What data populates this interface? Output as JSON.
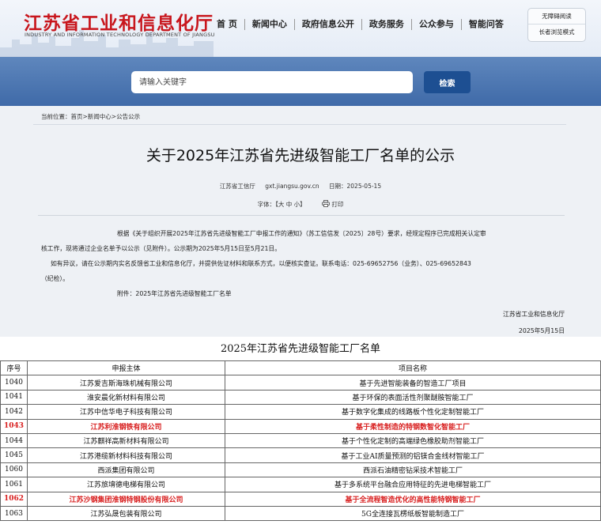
{
  "header": {
    "logo_title": "江苏省工业和信息化厅",
    "logo_subtitle": "INDUSTRY AND INFORMATION TECHNOLOGY DEPARTMENT OF JIANGSU",
    "nav": [
      "首 页",
      "新闻中心",
      "政府信息公开",
      "政务服务",
      "公众参与",
      "智能问答"
    ],
    "accessibility": [
      "无障碍阅读",
      "长者浏览模式"
    ]
  },
  "search": {
    "placeholder": "请输入关键字",
    "button": "检索"
  },
  "breadcrumb": {
    "label": "当前位置：",
    "path": "首页>新闻中心>公告公示"
  },
  "article": {
    "title": "关于2025年江苏省先进级智能工厂名单的公示",
    "source": "江苏省工信厅",
    "site": "gxt.jiangsu.gov.cn",
    "date": "日期：2025-05-15",
    "font_label": "字体：【",
    "font_sizes": "大  中  小",
    "font_close": "】",
    "print_label": "打印",
    "para1_line1": "根据《关于组织开展2025年江苏省先进级智能工厂申报工作的通知》（苏工信信发〔2025〕28号）要求，经规定程序已完成相关认定审",
    "para1_line2": "核工作，现将通过企业名单予以公示（见附件）。公示期为2025年5月15日至5月21日。",
    "para2_line1": "如有异议，请在公示期内实名反馈省工业和信息化厅，并提供佐证材料和联系方式，以便核实查证。联系电话：025-69652756（业务）、025-69652843",
    "para2_line2": "（纪检）。",
    "attachment": "附件：2025年江苏省先进级智能工厂名单",
    "signoff_org": "江苏省工业和信息化厅",
    "signoff_date": "2025年5月15日"
  },
  "table": {
    "title": "2025年江苏省先进级智能工厂名单",
    "headers": [
      "序号",
      "申报主体",
      "项目名称"
    ],
    "rows": [
      {
        "no": "1040",
        "company": "江苏爱吉斯海珠机械有限公司",
        "project": "基于先进智能装备的智造工厂项目",
        "highlight": false
      },
      {
        "no": "1041",
        "company": "淮安晨化新材料有限公司",
        "project": "基于环保的表面活性剂聚醚胺智能工厂",
        "highlight": false
      },
      {
        "no": "1042",
        "company": "江苏中信华电子科技有限公司",
        "project": "基于数字化集成的线路板个性化定制智能工厂",
        "highlight": false
      },
      {
        "no": "1043",
        "company": "江苏利淮钢铁有限公司",
        "project": "基于柔性制造的特钢数智化智能工厂",
        "highlight": true
      },
      {
        "no": "1044",
        "company": "江苏麒祥高新材料有限公司",
        "project": "基于个性化定制的高端绿色橡胶助剂智能工厂",
        "highlight": false
      },
      {
        "no": "1045",
        "company": "江苏港缆新材料科技有限公司",
        "project": "基于工业AI质量预测的铝镁合金线材智能工厂",
        "highlight": false
      },
      {
        "no": "1060",
        "company": "西派集团有限公司",
        "project": "西派石油精密钻采技术智能工厂",
        "highlight": false
      },
      {
        "no": "1061",
        "company": "江苏旅堉德电梯有限公司",
        "project": "基于多系统平台融合应用特征的先进电梯智能工厂",
        "highlight": false
      },
      {
        "no": "1062",
        "company": "江苏沙钢集团淮钢特钢股份有限公司",
        "project": "基于全流程智造优化的高性能特钢智能工厂",
        "highlight": true
      },
      {
        "no": "1063",
        "company": "江苏弘晟包装有限公司",
        "project": "5G全连接瓦楞纸板智能制造工厂",
        "highlight": false
      }
    ]
  },
  "colors": {
    "brand_red": "#c8161d",
    "search_band": "#4a74b0",
    "search_button": "#1d4f92",
    "highlight_text": "#d81e1e"
  }
}
